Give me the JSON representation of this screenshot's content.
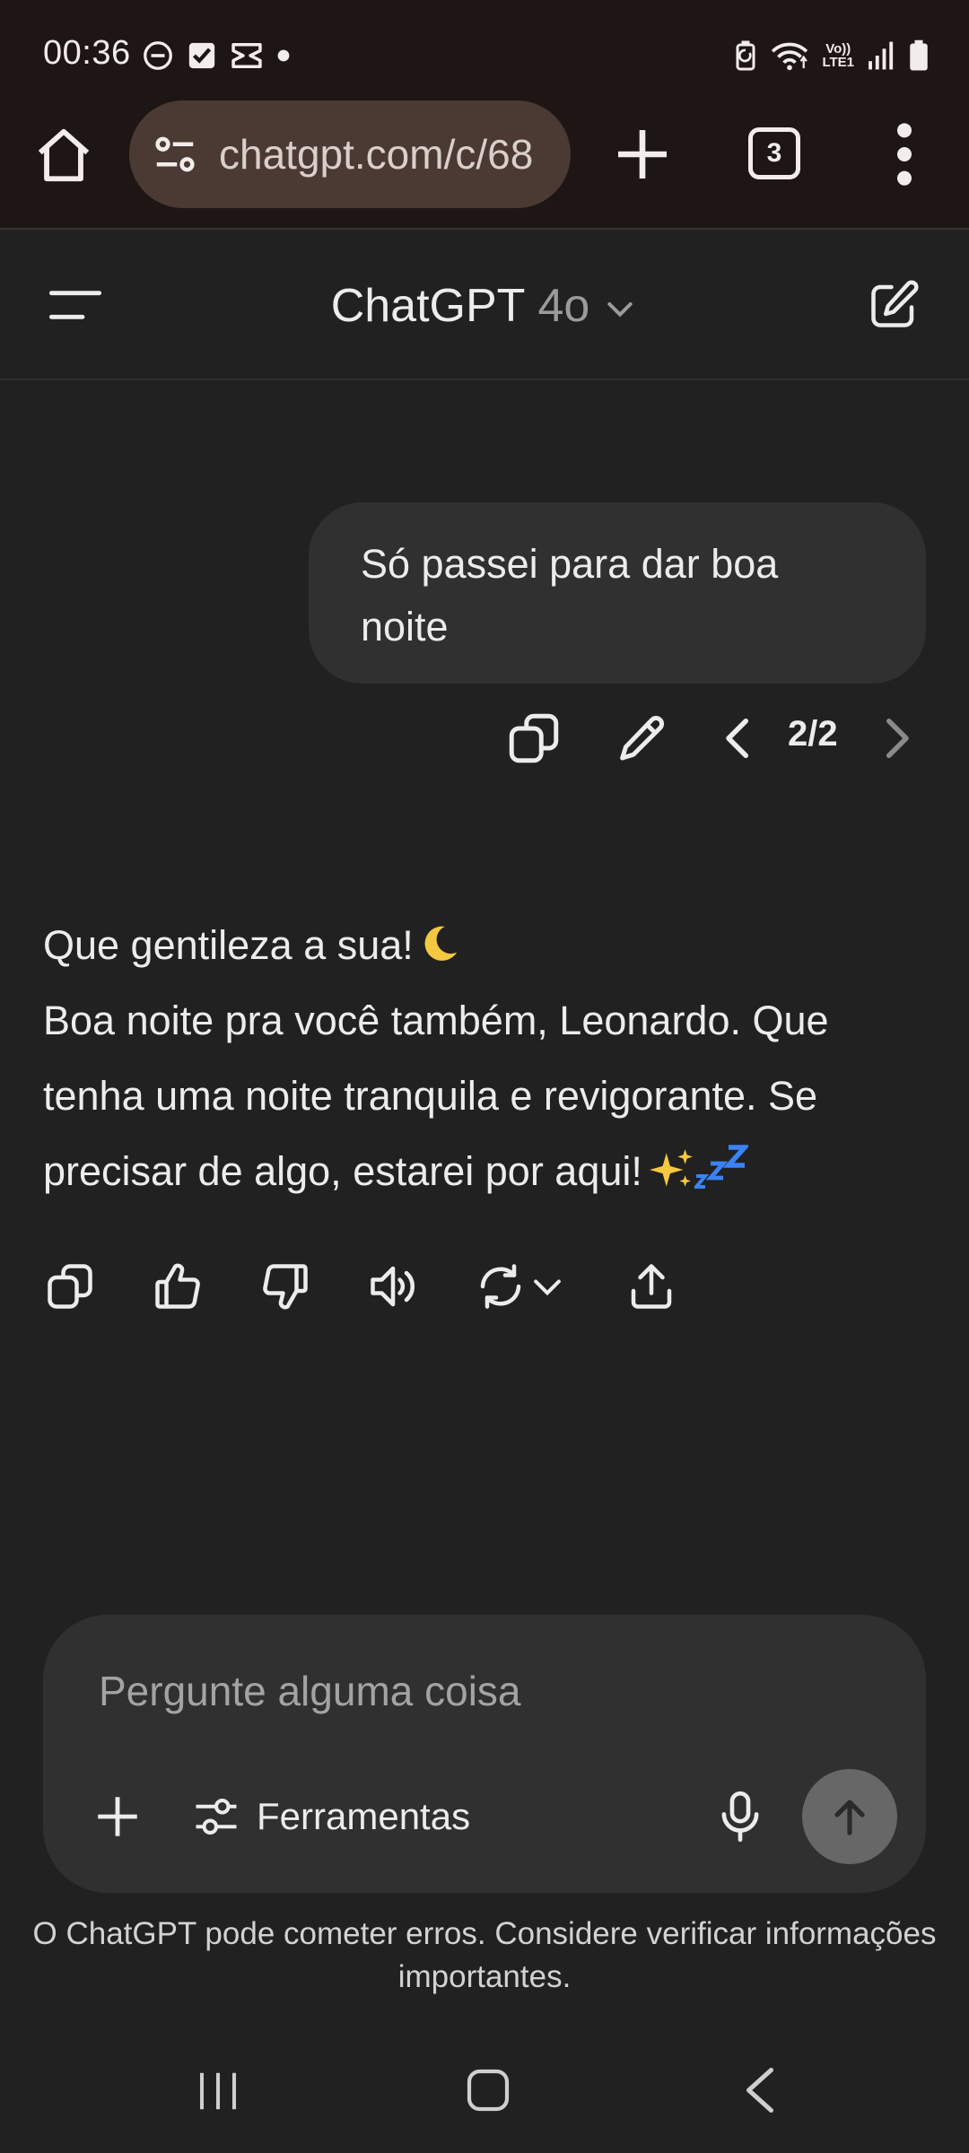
{
  "status_bar": {
    "time": "00:36",
    "network_label_top": "Vo))",
    "network_label_bottom": "LTE1",
    "icons_left": [
      "do-not-disturb-icon",
      "checkbox-app-icon",
      "capcut-icon",
      "dot-icon"
    ],
    "icons_right": [
      "battery-saver-icon",
      "wifi-icon",
      "signal-icon",
      "battery-icon"
    ]
  },
  "browser": {
    "url": "chatgpt.com/c/68",
    "tab_count": "3"
  },
  "app_header": {
    "title": "ChatGPT",
    "model": "4o"
  },
  "conversation": {
    "user_message": "Só passei para dar boa noite",
    "version_indicator": "2/2",
    "assistant_line1": "Que gentileza a sua!",
    "assistant_line2": "Boa noite pra você também, Leonardo. Que tenha uma noite tranquila e revigorante. Se precisar de algo, estarei por aqui!"
  },
  "composer": {
    "placeholder": "Pergunte alguma coisa",
    "tools_label": "Ferramentas"
  },
  "disclaimer": "O ChatGPT pode cometer erros. Considere verificar informações importantes.",
  "colors": {
    "background": "#212121",
    "surface": "#303030",
    "browser_chrome": "#1e1614",
    "url_pill": "#4a3a33",
    "send_button": "#676767"
  }
}
